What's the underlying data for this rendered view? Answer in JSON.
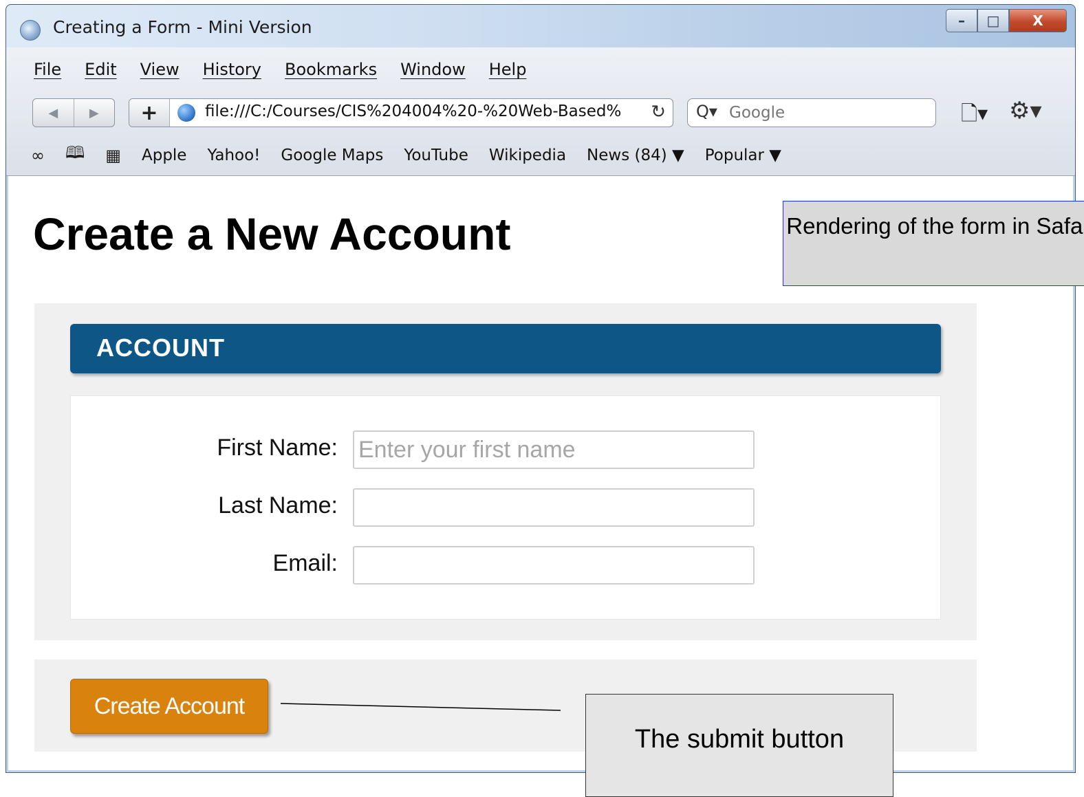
{
  "window": {
    "title": "Creating a Form - Mini Version",
    "controls": {
      "minimize": "–",
      "maximize": "□",
      "close": "X"
    }
  },
  "menu": [
    "File",
    "Edit",
    "View",
    "History",
    "Bookmarks",
    "Window",
    "Help"
  ],
  "toolbar": {
    "back_icon": "◀",
    "forward_icon": "▶",
    "add_icon": "+",
    "url": "file:///C:/Courses/CIS%204004%20-%20Web-Based%",
    "reload_icon": "↻",
    "search_placeholder": "Google",
    "search_icon": "Q▾",
    "page_menu_icon": "🗋▾",
    "settings_icon": "⚙▾"
  },
  "bookmarks": {
    "icons": [
      "∞",
      "🕮",
      "▦"
    ],
    "items": [
      "Apple",
      "Yahoo!",
      "Google Maps",
      "YouTube",
      "Wikipedia",
      "News (84) ▼",
      "Popular ▼"
    ]
  },
  "page": {
    "heading": "Create a New Account",
    "section_title": "ACCOUNT",
    "fields": [
      {
        "label": "First Name:",
        "value": "",
        "placeholder": "Enter your first name"
      },
      {
        "label": "Last Name:",
        "value": "",
        "placeholder": ""
      },
      {
        "label": "Email:",
        "value": "",
        "placeholder": ""
      }
    ],
    "submit_label": "Create Account"
  },
  "annotations": {
    "top": "Rendering of the form in Safari",
    "bottom": "The submit button"
  },
  "colors": {
    "section_header": "#0d5685",
    "submit_button": "#d9820e",
    "panel_background": "#f0f0f0"
  }
}
